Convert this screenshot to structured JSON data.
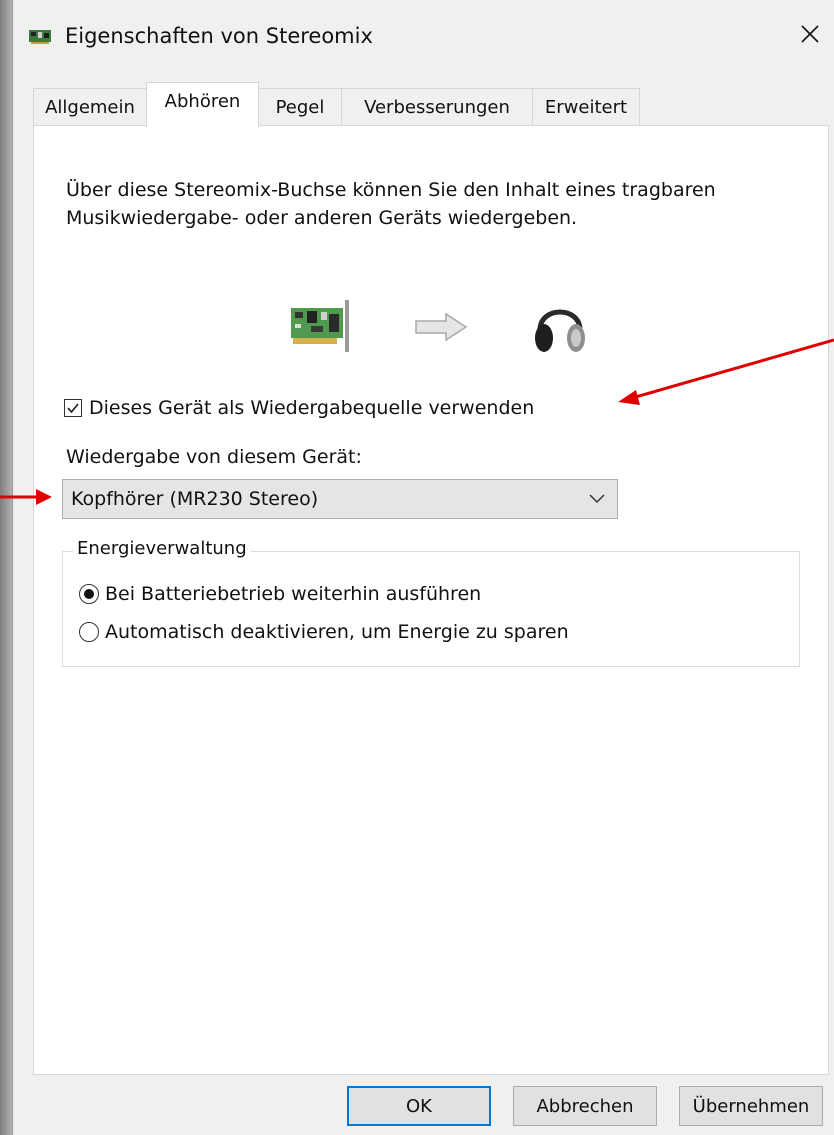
{
  "window": {
    "title": "Eigenschaften von Stereomix",
    "close_symbol": "✕"
  },
  "tabs": [
    {
      "label": "Allgemein",
      "active": false
    },
    {
      "label": "Abhören",
      "active": true
    },
    {
      "label": "Pegel",
      "active": false
    },
    {
      "label": "Verbesserungen",
      "active": false
    },
    {
      "label": "Erweitert",
      "active": false
    }
  ],
  "listen": {
    "description_line1": "Über diese Stereomix-Buchse können Sie den Inhalt eines tragbaren",
    "description_line2": "Musikwiedergabe- oder anderen Geräts wiedergeben.",
    "illustration_icons": [
      "sound-card-icon",
      "arrow-right-icon",
      "headphones-icon"
    ],
    "use_as_source_label": "Dieses Gerät als Wiedergabequelle verwenden",
    "use_as_source_checked": true,
    "playback_label": "Wiedergabe von diesem Gerät:",
    "playback_device": "Kopfhörer (MR230 Stereo)"
  },
  "power": {
    "group_title": "Energieverwaltung",
    "options": [
      {
        "label": "Bei Batteriebetrieb weiterhin ausführen",
        "selected": true
      },
      {
        "label": "Automatisch deaktivieren, um Energie zu sparen",
        "selected": false
      }
    ]
  },
  "buttons": {
    "ok": "OK",
    "cancel": "Abbrechen",
    "apply": "Übernehmen"
  },
  "colors": {
    "annotation_arrow": "#e00000",
    "default_button_border": "#0078d7"
  }
}
